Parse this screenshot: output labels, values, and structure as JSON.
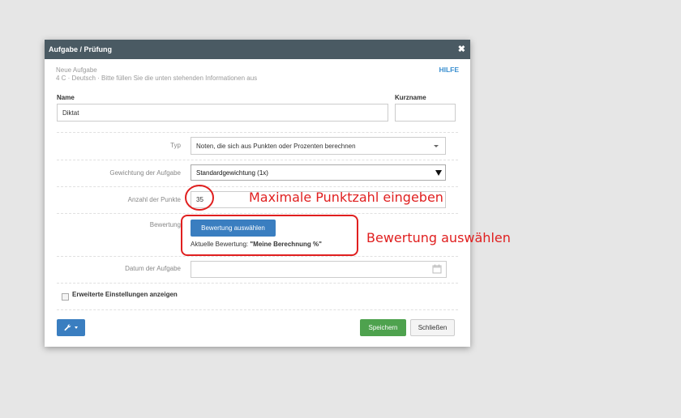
{
  "modal": {
    "title": "Aufgabe / Prüfung",
    "close_glyph": "✖",
    "subtitle_line1": "Neue Aufgabe",
    "subtitle_line2": "4 C · Deutsch · Bitte füllen Sie die unten stehenden Informationen aus",
    "help_label": "HILFE"
  },
  "form": {
    "name_label": "Name",
    "name_value": "Diktat",
    "short_label": "Kurzname",
    "short_value": "",
    "type_label": "Typ",
    "type_value": "Noten, die sich aus Punkten oder Prozenten berechnen",
    "weight_label": "Gewichtung der Aufgabe",
    "weight_value": "Standardgewichtung (1x)",
    "points_label": "Anzahl der Punkte",
    "points_value": "35",
    "rating_label": "Bewertung",
    "rating_button": "Bewertung auswählen",
    "rating_current_prefix": "Aktuelle Bewertung: ",
    "rating_current_value": "\"Meine Berechnung %\"",
    "date_label": "Datum der Aufgabe",
    "date_value": "",
    "advanced_label": "Erweiterte Einstellungen anzeigen"
  },
  "footer": {
    "save_label": "Speichern",
    "close_label": "Schließen"
  },
  "annotations": {
    "points_note": "Maximale Punktzahl eingeben",
    "rating_note": "Bewertung auswählen",
    "color": "#e02020"
  },
  "icons": {
    "tools": "wrench-icon",
    "calendar": "calendar-icon",
    "dropdown": "caret-down-icon"
  },
  "colors": {
    "header_bg": "#4a5a63",
    "primary": "#3a7ec0",
    "success": "#4ea24e",
    "link": "#3a8fd0"
  }
}
